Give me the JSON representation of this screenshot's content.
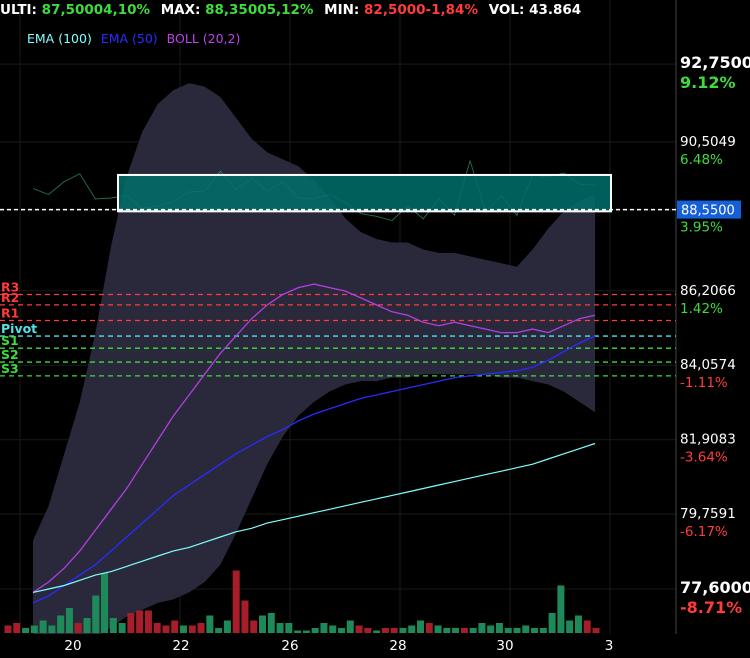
{
  "header": {
    "last_label": "ULTI:",
    "last_value": "87,5000",
    "last_change": "4,10%",
    "max_label": "MAX:",
    "max_value": "88,3500",
    "max_change": "5,12%",
    "min_label": "MIN:",
    "min_value": "82,5000",
    "min_change": "-1,84%",
    "vol_label": "VOL:",
    "vol_value": "43.864"
  },
  "legend": {
    "ema100": "EMA (100)",
    "ema50": "EMA (50)",
    "boll": "BOLL (20,2)"
  },
  "colors": {
    "positive": "#3ddc3d",
    "negative": "#ff3b3b",
    "ema100": "#7fffff",
    "ema50": "#2b2bff",
    "boll_mid": "#b040e0",
    "boll_band": "#2c2a3e",
    "price": "#3fcf9f",
    "zone_fill": "#006e6b",
    "resistance": "#ff3b3b",
    "pivot": "#55e0e6",
    "support": "#3ddc3d",
    "vol_up": "#1e8a5a",
    "vol_down": "#a51e2a"
  },
  "levels": {
    "R3": "R3",
    "R2": "R2",
    "R1": "R1",
    "Pivot": "Pivot",
    "S1": "S1",
    "S2": "S2",
    "S3": "S3"
  },
  "current_price": "88,5500",
  "chart_data": {
    "type": "line",
    "x_ticks": [
      "20",
      "22",
      "26",
      "28",
      "30",
      "3"
    ],
    "y_ticks": [
      {
        "price": "92,7500",
        "pct": "9.12%",
        "sign": "pos",
        "value": 92.75
      },
      {
        "price": "90,5049",
        "pct": "6.48%",
        "sign": "pos",
        "value": 90.5049
      },
      {
        "price": "88,5500",
        "pct": "3.95%",
        "sign": "pos",
        "value": 88.55
      },
      {
        "price": "86,2066",
        "pct": "1.42%",
        "sign": "pos",
        "value": 86.2066
      },
      {
        "price": "84,0574",
        "pct": "-1.11%",
        "sign": "neg",
        "value": 84.0574
      },
      {
        "price": "81,9083",
        "pct": "-3.64%",
        "sign": "neg",
        "value": 81.9083
      },
      {
        "price": "79,7591",
        "pct": "-6.17%",
        "sign": "neg",
        "value": 79.7591
      },
      {
        "price": "77,6000",
        "pct": "-8.71%",
        "sign": "neg",
        "value": 77.6
      }
    ],
    "ylim": [
      76.3,
      94.6
    ],
    "pivot_levels": {
      "R3": 86.1,
      "R2": 85.8,
      "R1": 85.35,
      "Pivot": 84.9,
      "S1": 84.55,
      "S2": 84.15,
      "S3": 83.75
    },
    "zone": {
      "from": 88.5,
      "to": 89.55
    },
    "price": [
      89.1,
      89.1,
      89.3,
      89.7,
      88.8,
      89.0,
      88.9,
      88.7,
      88.6,
      88.9,
      89.0,
      89.2,
      89.6,
      89.25,
      89.4,
      89.2,
      89.3,
      89.0,
      88.8,
      89.1,
      88.7,
      88.55,
      88.3,
      88.35,
      88.6,
      88.4,
      88.8,
      88.5,
      89.9,
      88.6,
      88.9,
      88.5,
      89.5,
      89.6,
      89.55,
      89.4,
      89.2
    ],
    "ema100": [
      77.5,
      77.6,
      77.7,
      77.85,
      78.0,
      78.1,
      78.25,
      78.4,
      78.55,
      78.7,
      78.8,
      78.95,
      79.1,
      79.25,
      79.35,
      79.5,
      79.6,
      79.7,
      79.8,
      79.9,
      80.0,
      80.1,
      80.2,
      80.3,
      80.4,
      80.5,
      80.6,
      80.7,
      80.8,
      80.9,
      81.0,
      81.1,
      81.2,
      81.35,
      81.5,
      81.65,
      81.8
    ],
    "ema50": [
      77.2,
      77.4,
      77.7,
      78.0,
      78.3,
      78.7,
      79.1,
      79.5,
      79.9,
      80.3,
      80.6,
      80.9,
      81.2,
      81.5,
      81.75,
      82.0,
      82.2,
      82.45,
      82.65,
      82.8,
      82.95,
      83.1,
      83.2,
      83.3,
      83.4,
      83.5,
      83.6,
      83.7,
      83.75,
      83.8,
      83.85,
      83.9,
      84.0,
      84.2,
      84.45,
      84.7,
      84.9
    ],
    "boll_mid": [
      77.5,
      77.8,
      78.2,
      78.7,
      79.3,
      79.9,
      80.5,
      81.2,
      81.9,
      82.6,
      83.2,
      83.8,
      84.4,
      84.9,
      85.4,
      85.8,
      86.1,
      86.3,
      86.4,
      86.3,
      86.2,
      86.0,
      85.8,
      85.6,
      85.5,
      85.3,
      85.2,
      85.3,
      85.2,
      85.1,
      85.0,
      85.0,
      85.1,
      85.0,
      85.2,
      85.4,
      85.5
    ],
    "boll_upper": [
      79.0,
      80.0,
      81.5,
      83.0,
      85.0,
      87.5,
      89.5,
      90.8,
      91.6,
      92.0,
      92.2,
      92.1,
      91.8,
      91.2,
      90.6,
      90.2,
      90.0,
      89.8,
      89.4,
      88.9,
      88.3,
      87.9,
      87.7,
      87.6,
      87.6,
      87.4,
      87.3,
      87.3,
      87.2,
      87.1,
      87.0,
      86.9,
      87.4,
      88.0,
      88.5,
      88.8,
      89.0
    ],
    "boll_lower": [
      76.0,
      76.0,
      76.0,
      76.0,
      76.2,
      76.5,
      76.8,
      77.0,
      77.2,
      77.3,
      77.5,
      77.8,
      78.3,
      79.2,
      80.2,
      81.2,
      82.0,
      82.6,
      83.0,
      83.3,
      83.5,
      83.6,
      83.6,
      83.7,
      83.7,
      83.8,
      83.8,
      83.8,
      83.8,
      83.8,
      83.7,
      83.7,
      83.6,
      83.5,
      83.3,
      83.0,
      82.7
    ],
    "volume": [
      {
        "v": 6,
        "up": false
      },
      {
        "v": 8,
        "up": false
      },
      {
        "v": 4,
        "up": true
      },
      {
        "v": 6,
        "up": true
      },
      {
        "v": 10,
        "up": true
      },
      {
        "v": 6,
        "up": true
      },
      {
        "v": 14,
        "up": true
      },
      {
        "v": 20,
        "up": true
      },
      {
        "v": 8,
        "up": false
      },
      {
        "v": 12,
        "up": true
      },
      {
        "v": 30,
        "up": true
      },
      {
        "v": 48,
        "up": true
      },
      {
        "v": 12,
        "up": true
      },
      {
        "v": 8,
        "up": true
      },
      {
        "v": 16,
        "up": false
      },
      {
        "v": 18,
        "up": false
      },
      {
        "v": 18,
        "up": false
      },
      {
        "v": 8,
        "up": false
      },
      {
        "v": 6,
        "up": false
      },
      {
        "v": 10,
        "up": false
      },
      {
        "v": 6,
        "up": true
      },
      {
        "v": 6,
        "up": false
      },
      {
        "v": 8,
        "up": false
      },
      {
        "v": 14,
        "up": true
      },
      {
        "v": 4,
        "up": true
      },
      {
        "v": 10,
        "up": true
      },
      {
        "v": 50,
        "up": false
      },
      {
        "v": 26,
        "up": false
      },
      {
        "v": 10,
        "up": false
      },
      {
        "v": 14,
        "up": true
      },
      {
        "v": 16,
        "up": true
      },
      {
        "v": 8,
        "up": true
      },
      {
        "v": 8,
        "up": true
      },
      {
        "v": 2,
        "up": true
      },
      {
        "v": 2,
        "up": true
      },
      {
        "v": 4,
        "up": true
      },
      {
        "v": 8,
        "up": true
      },
      {
        "v": 6,
        "up": true
      },
      {
        "v": 4,
        "up": true
      },
      {
        "v": 10,
        "up": true
      },
      {
        "v": 6,
        "up": false
      },
      {
        "v": 4,
        "up": false
      },
      {
        "v": 2,
        "up": true
      },
      {
        "v": 4,
        "up": false
      },
      {
        "v": 4,
        "up": false
      },
      {
        "v": 4,
        "up": true
      },
      {
        "v": 6,
        "up": true
      },
      {
        "v": 10,
        "up": true
      },
      {
        "v": 8,
        "up": false
      },
      {
        "v": 6,
        "up": true
      },
      {
        "v": 4,
        "up": true
      },
      {
        "v": 4,
        "up": true
      },
      {
        "v": 4,
        "up": false
      },
      {
        "v": 4,
        "up": true
      },
      {
        "v": 8,
        "up": true
      },
      {
        "v": 6,
        "up": true
      },
      {
        "v": 8,
        "up": true
      },
      {
        "v": 4,
        "up": true
      },
      {
        "v": 4,
        "up": true
      },
      {
        "v": 6,
        "up": true
      },
      {
        "v": 4,
        "up": true
      },
      {
        "v": 4,
        "up": true
      },
      {
        "v": 16,
        "up": true
      },
      {
        "v": 38,
        "up": true
      },
      {
        "v": 10,
        "up": true
      },
      {
        "v": 14,
        "up": true
      },
      {
        "v": 10,
        "up": false
      },
      {
        "v": 4,
        "up": false
      }
    ]
  }
}
